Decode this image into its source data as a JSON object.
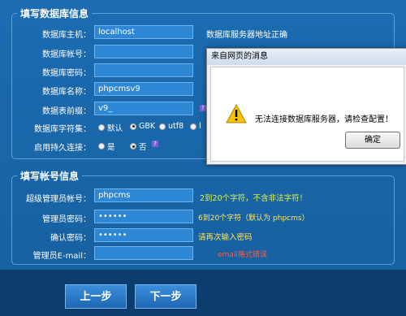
{
  "db_section": {
    "legend": "填写数据库信息",
    "host_label": "数据库主机：",
    "host_value": "localhost",
    "host_status": "数据库服务器地址正确",
    "account_label": "数据库帐号：",
    "account_value": "",
    "password_label": "数据库密码：",
    "password_value": "",
    "name_label": "数据库名称：",
    "name_value": "phpcmsv9",
    "prefix_label": "数据表前缀：",
    "prefix_value": "v9_",
    "charset_label": "数据库字符集：",
    "charset_options": [
      "默认",
      "GBK",
      "utf8",
      "l"
    ],
    "charset_selected": "GBK",
    "persist_label": "启用持久连接：",
    "persist_options": [
      "是",
      "否"
    ],
    "persist_selected": "否"
  },
  "account_section": {
    "legend": "填写帐号信息",
    "admin_label": "超级管理员帐号：",
    "admin_value": "phpcms",
    "admin_hint": "2到20个字符，不含非法字符！",
    "pwd_label": "管理员密码：",
    "pwd_value": "••••••",
    "pwd_hint": "6到20个字符（默认为 phpcms）",
    "confirm_label": "确认密码：",
    "confirm_value": "••••••",
    "confirm_hint": "请再次输入密码",
    "email_label": "管理员E-mail：",
    "email_value": "",
    "email_hint": "email格式错误"
  },
  "buttons": {
    "prev": "上一步",
    "next": "下一步"
  },
  "dialog": {
    "title": "来自网页的消息",
    "message": "无法连接数据库服务器，请检查配置！",
    "ok": "确定"
  },
  "colors": {
    "hint_green": "#d7f25a",
    "hint_yellow": "#ffe35a",
    "hint_error": "#ff5a3c"
  }
}
